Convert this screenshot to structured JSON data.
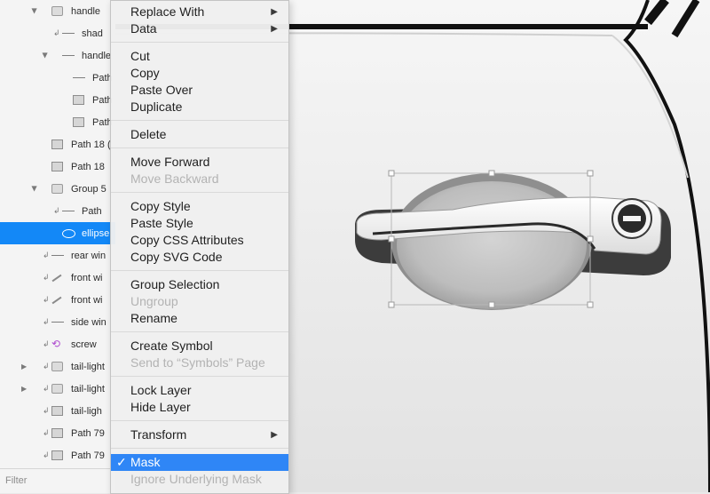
{
  "layers": [
    {
      "label": "handle",
      "icon": "folder-icon",
      "indent": 0,
      "disclosure": "expanded",
      "selected": false
    },
    {
      "label": "shad",
      "icon": "line-icon",
      "indent": 1,
      "disclosure": "none",
      "marker": "↲",
      "selected": false
    },
    {
      "label": "handle",
      "icon": "line-icon",
      "indent": 1,
      "disclosure": "expanded",
      "selected": false
    },
    {
      "label": "Path",
      "icon": "line-icon",
      "indent": 2,
      "disclosure": "none",
      "selected": false
    },
    {
      "label": "Path",
      "icon": "shape-icon",
      "indent": 2,
      "disclosure": "none",
      "selected": false
    },
    {
      "label": "Path",
      "icon": "shape-icon",
      "indent": 2,
      "disclosure": "none",
      "selected": false
    },
    {
      "label": "Path 18 (",
      "icon": "shape-icon",
      "indent": 0,
      "disclosure": "none",
      "selected": false
    },
    {
      "label": "Path 18",
      "icon": "shape-icon",
      "indent": 0,
      "disclosure": "none",
      "selected": false
    },
    {
      "label": "Group 5",
      "icon": "folder-icon",
      "indent": 0,
      "disclosure": "expanded",
      "selected": false
    },
    {
      "label": "Path",
      "icon": "line-icon",
      "indent": 1,
      "disclosure": "none",
      "marker": "↲",
      "selected": false
    },
    {
      "label": "ellipse",
      "icon": "ellipse-icon",
      "indent": 1,
      "disclosure": "none",
      "selected": true
    },
    {
      "label": "rear win",
      "icon": "line-icon",
      "indent": 0,
      "disclosure": "none",
      "marker": "↲",
      "selected": false
    },
    {
      "label": "front wi",
      "icon": "slash-icon",
      "indent": 0,
      "disclosure": "none",
      "marker": "↲",
      "selected": false
    },
    {
      "label": "front wi",
      "icon": "slash-icon",
      "indent": 0,
      "disclosure": "none",
      "marker": "↲",
      "selected": false
    },
    {
      "label": "side win",
      "icon": "line-icon",
      "indent": 0,
      "disclosure": "none",
      "marker": "↲",
      "selected": false
    },
    {
      "label": "screw",
      "icon": "screw-symbol-icon",
      "indent": 0,
      "disclosure": "none",
      "marker": "↲",
      "selected": false
    },
    {
      "label": "tail-light",
      "icon": "folder-icon",
      "indent": 0,
      "disclosure": "collapsed",
      "marker": "↲",
      "selected": false
    },
    {
      "label": "tail-light",
      "icon": "folder-icon",
      "indent": 0,
      "disclosure": "collapsed",
      "marker": "↲",
      "selected": false
    },
    {
      "label": "tail-ligh",
      "icon": "shape-icon",
      "indent": 0,
      "disclosure": "none",
      "marker": "↲",
      "selected": false
    },
    {
      "label": "Path 79",
      "icon": "shape-icon",
      "indent": 0,
      "disclosure": "none",
      "marker": "↲",
      "selected": false
    },
    {
      "label": "Path 79",
      "icon": "shape-icon",
      "indent": 0,
      "disclosure": "none",
      "marker": "↲",
      "selected": false
    }
  ],
  "filter": {
    "placeholder": "Filter"
  },
  "menu": {
    "groups": [
      [
        {
          "label": "Replace With",
          "enabled": true,
          "submenu": true
        },
        {
          "label": "Data",
          "enabled": true,
          "submenu": true
        }
      ],
      [
        {
          "label": "Cut",
          "enabled": true
        },
        {
          "label": "Copy",
          "enabled": true
        },
        {
          "label": "Paste Over",
          "enabled": true
        },
        {
          "label": "Duplicate",
          "enabled": true
        }
      ],
      [
        {
          "label": "Delete",
          "enabled": true
        }
      ],
      [
        {
          "label": "Move Forward",
          "enabled": true
        },
        {
          "label": "Move Backward",
          "enabled": false
        }
      ],
      [
        {
          "label": "Copy Style",
          "enabled": true
        },
        {
          "label": "Paste Style",
          "enabled": true
        },
        {
          "label": "Copy CSS Attributes",
          "enabled": true
        },
        {
          "label": "Copy SVG Code",
          "enabled": true
        }
      ],
      [
        {
          "label": "Group Selection",
          "enabled": true
        },
        {
          "label": "Ungroup",
          "enabled": false
        },
        {
          "label": "Rename",
          "enabled": true
        }
      ],
      [
        {
          "label": "Create Symbol",
          "enabled": true
        },
        {
          "label": "Send to “Symbols” Page",
          "enabled": false
        }
      ],
      [
        {
          "label": "Lock Layer",
          "enabled": true
        },
        {
          "label": "Hide Layer",
          "enabled": true
        }
      ],
      [
        {
          "label": "Transform",
          "enabled": true,
          "submenu": true
        }
      ],
      [
        {
          "label": "Mask",
          "enabled": true,
          "checked": true,
          "highlighted": true
        },
        {
          "label": "Ignore Underlying Mask",
          "enabled": false
        }
      ]
    ],
    "check_glyph": "✓",
    "submenu_glyph": "▶"
  },
  "colors": {
    "selection": "#1388f7",
    "menu_highlight": "#2f86f6",
    "screw_icon": "#b04fd0"
  }
}
